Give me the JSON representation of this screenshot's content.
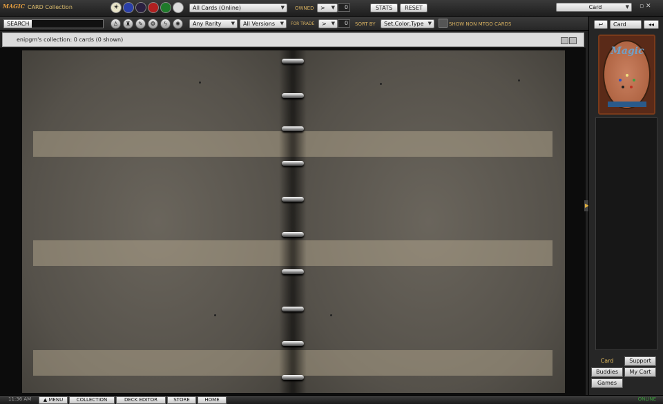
{
  "header": {
    "logo_text": "MAGIC",
    "app_title": "CARD Collection",
    "collection_filter": "All Cards (Online)",
    "owned_label": "OWNED",
    "owned_operator": ">",
    "owned_value": "0",
    "stats_label": "STATS",
    "reset_label": "RESET",
    "view_select": "Card"
  },
  "mana_filters": [
    "white",
    "blue",
    "black",
    "red",
    "green",
    "colorless"
  ],
  "filterbar": {
    "search_label": "SEARCH",
    "search_value": "",
    "rarity": "Any Rarity",
    "versions": "All Versions",
    "for_trade_label": "FOR TRADE",
    "for_trade_operator": ">",
    "for_trade_value": "0",
    "sort_label": "SORT BY",
    "sort_value": "Set,Color,Type",
    "show_non_mtgo_label": "SHOW NON MTGO CARDS"
  },
  "collection": {
    "summary": "enipgm's collection: 0 cards (0 shown)"
  },
  "right_panel": {
    "card_box": "Card",
    "card_back_title": "Magic",
    "tabs": [
      "Card",
      "Support",
      "Buddies",
      "My Cart",
      "Games"
    ],
    "active_tab": "Card"
  },
  "bottombar": {
    "clock": "11:36 AM",
    "menu_label": "MENU",
    "nav": [
      "COLLECTION",
      "DECK EDITOR",
      "STORE",
      "HOME"
    ],
    "status": "ONLINE"
  }
}
